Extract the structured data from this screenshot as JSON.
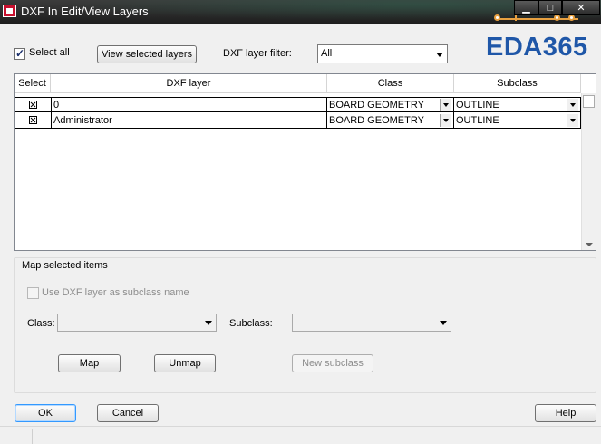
{
  "window": {
    "title": "DXF In Edit/View Layers",
    "minimize_glyph": "▁",
    "maximize_glyph": "□",
    "close_glyph": "✕"
  },
  "logo": {
    "text": "EDA365",
    "color": "#1f57a8"
  },
  "toolbar": {
    "select_all_label": "Select all",
    "select_all_checked": true,
    "view_selected_label": "View selected layers",
    "filter_label": "DXF layer filter:",
    "filter_value": "All"
  },
  "grid": {
    "columns": [
      "Select",
      "DXF layer",
      "Class",
      "Subclass"
    ],
    "rows": [
      {
        "selected": true,
        "layer": "0",
        "class": "BOARD GEOMETRY",
        "subclass": "OUTLINE"
      },
      {
        "selected": true,
        "layer": "Administrator",
        "class": "BOARD GEOMETRY",
        "subclass": "OUTLINE"
      }
    ]
  },
  "map": {
    "group_label": "Map selected items",
    "use_dxf_label": "Use DXF layer as subclass name",
    "class_label": "Class:",
    "class_value": "",
    "subclass_label": "Subclass:",
    "subclass_value": "",
    "map_label": "Map",
    "unmap_label": "Unmap",
    "new_subclass_label": "New subclass"
  },
  "footer": {
    "ok_label": "OK",
    "cancel_label": "Cancel",
    "help_label": "Help"
  }
}
